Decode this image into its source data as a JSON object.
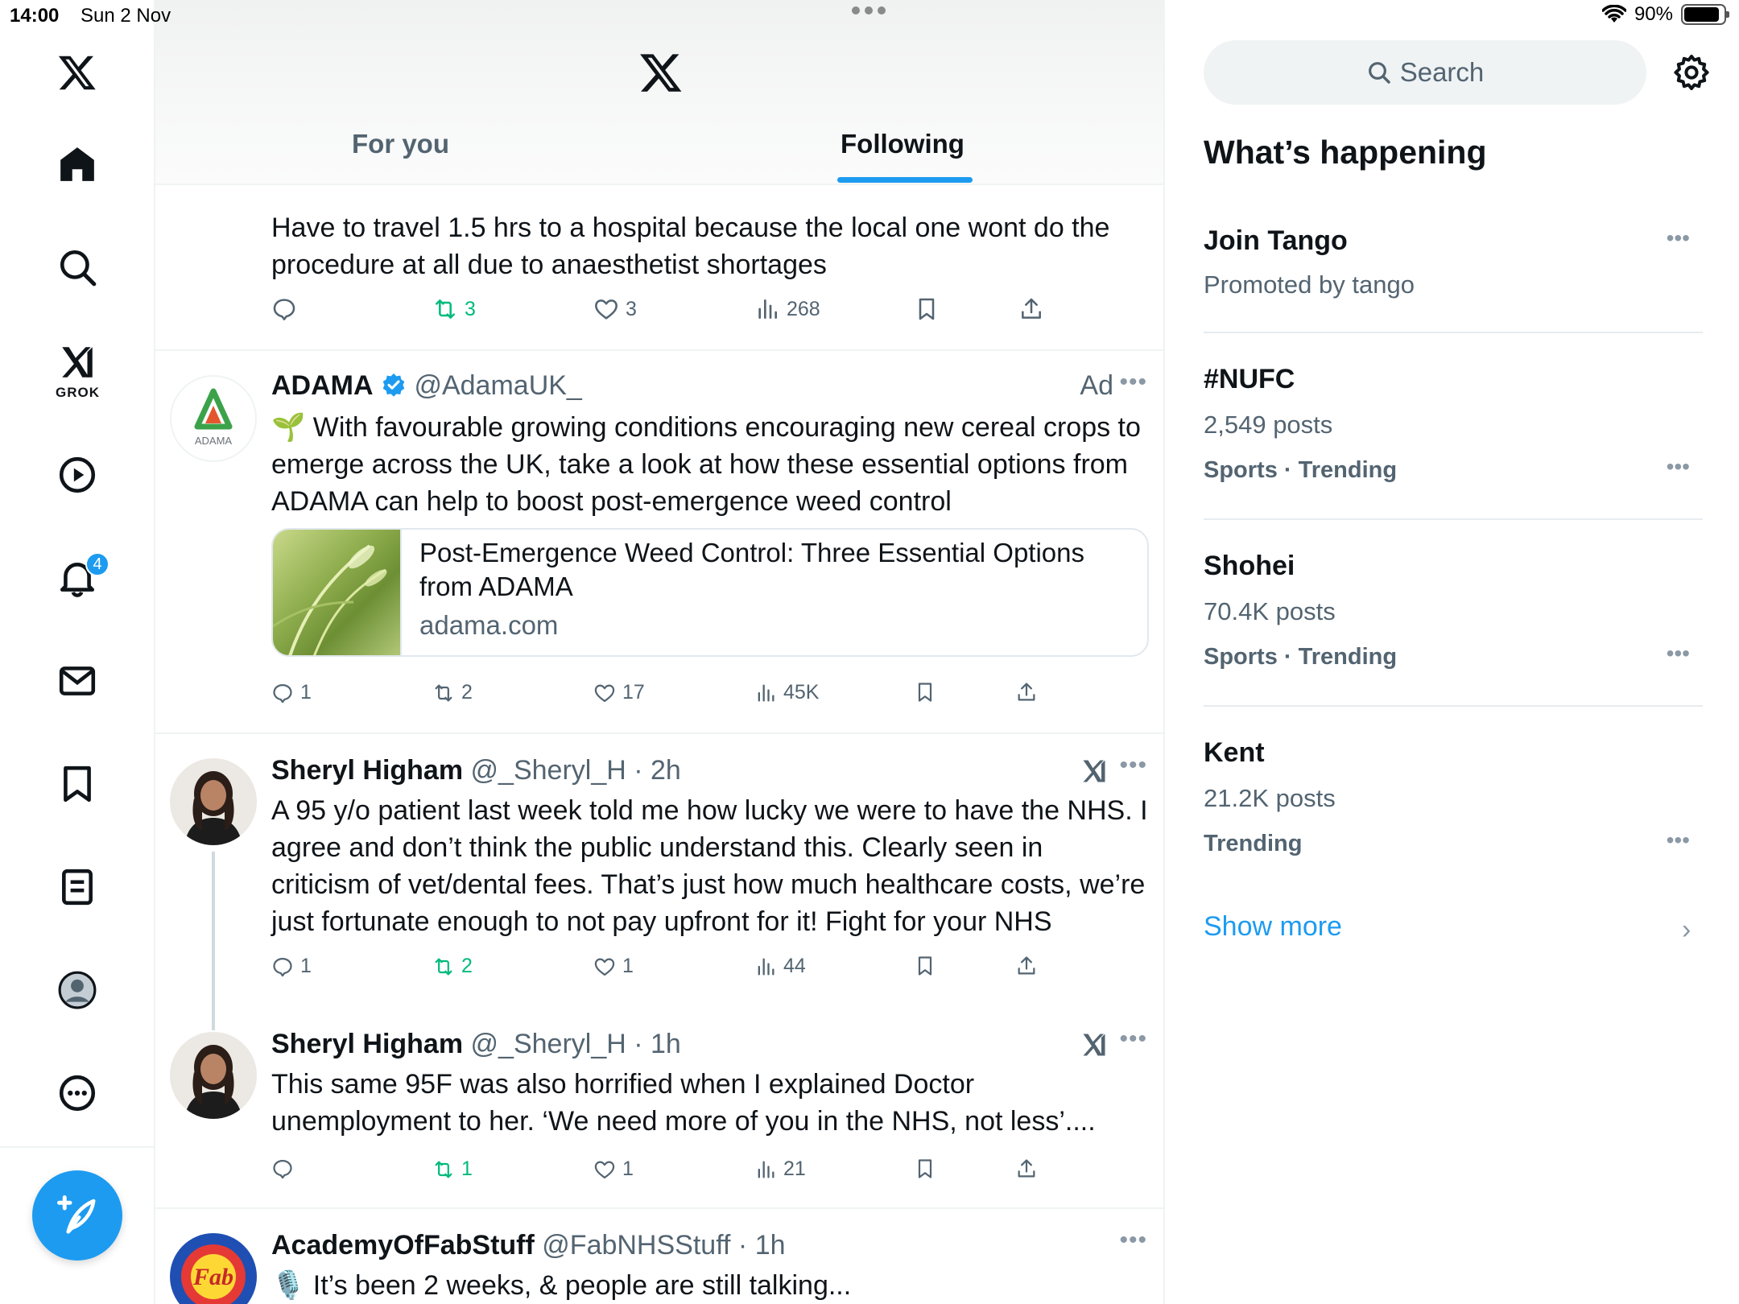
{
  "status": {
    "time": "14:00",
    "date": "Sun 2 Nov",
    "battery": "90%"
  },
  "nav": {
    "grok_label": "GROK",
    "notifications_badge": "4"
  },
  "tabs": {
    "for_you": "For you",
    "following": "Following"
  },
  "posts": [
    {
      "text": "Have to travel 1.5 hrs to a hospital because the local one wont do the procedure at all due to anaesthetist shortages",
      "replies": "",
      "reposts": "3",
      "likes": "3",
      "views": "268"
    },
    {
      "name": "ADAMA",
      "handle": "@AdamaUK_",
      "ad_label": "Ad",
      "avatar_text": "ADAMA",
      "text": "🌱 With favourable growing conditions encouraging new cereal crops to emerge across the UK, take a look at how these essential options from ADAMA can help to boost post-emergence weed control",
      "card_title": "Post-Emergence Weed Control: Three Essential Options from ADAMA",
      "card_domain": "adama.com",
      "replies": "1",
      "reposts": "2",
      "likes": "17",
      "views": "45K"
    },
    {
      "name": "Sheryl Higham",
      "handle": "@_Sheryl_H · 2h",
      "text": "A 95 y/o patient last week told me how lucky we were to have the NHS. I agree and don’t think the public understand this. Clearly seen in criticism of vet/dental fees. That’s just how much healthcare costs, we’re just fortunate enough to not pay upfront for it! Fight for your NHS",
      "replies": "1",
      "reposts": "2",
      "likes": "1",
      "views": "44"
    },
    {
      "name": "Sheryl Higham",
      "handle": "@_Sheryl_H · 1h",
      "text": "This same 95F was also horrified when I explained Doctor unemployment to her. ‘We need more of you in the NHS, not less’....",
      "replies": "",
      "reposts": "1",
      "likes": "1",
      "views": "21"
    },
    {
      "name": "AcademyOfFabStuff",
      "handle": "@FabNHSStuff · 1h",
      "avatar_text": "Fab",
      "text": "🎙️ It’s been 2 weeks, & people are still talking..."
    }
  ],
  "sidebar": {
    "search_placeholder": "Search",
    "section_title": "What’s happening",
    "trends": [
      {
        "title": "Join Tango",
        "sub": "Promoted by tango",
        "category": ""
      },
      {
        "title": "#NUFC",
        "sub": "2,549 posts",
        "category": "Sports · Trending"
      },
      {
        "title": "Shohei",
        "sub": "70.4K posts",
        "category": "Sports · Trending"
      },
      {
        "title": "Kent",
        "sub": "21.2K posts",
        "category": "Trending"
      }
    ],
    "show_more": "Show more"
  },
  "colors": {
    "accent": "#1d9bf0",
    "repost_green": "#00ba7c",
    "secondary_text": "#536471"
  }
}
